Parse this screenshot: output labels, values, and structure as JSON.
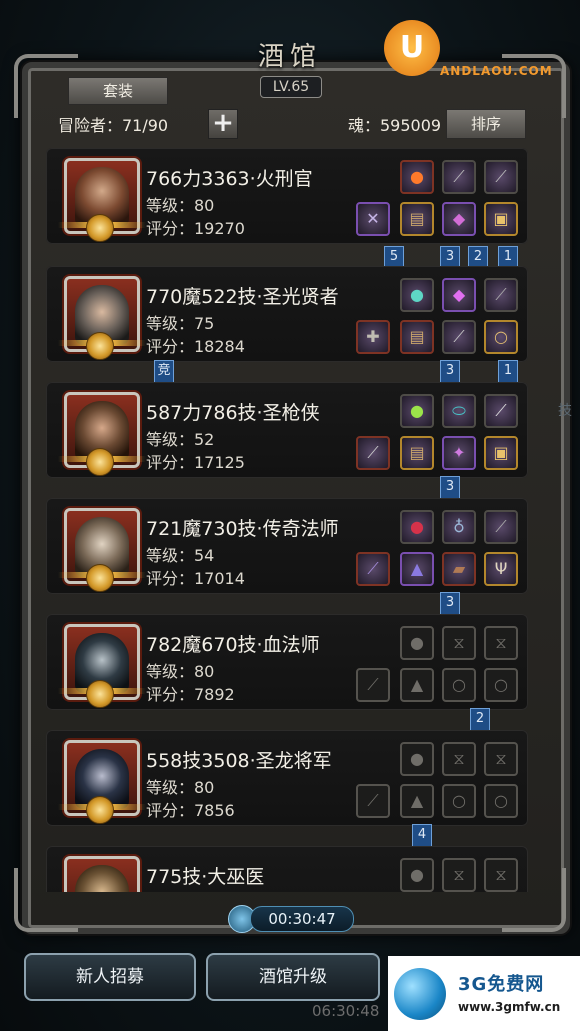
{
  "header": {
    "title": "酒馆",
    "level": "LV.65",
    "set_button": "套装",
    "adventurers": "冒险者：71/90",
    "soul": "魂：595009",
    "sort_button": "排序",
    "add_symbol": "+"
  },
  "heroes": [
    {
      "name": "766力3363·火刑官",
      "level": "等级：80",
      "score": "评分：19270",
      "portrait_color": "#8b2c1c"
    },
    {
      "name": "770魔522技·圣光贤者",
      "level": "等级：75",
      "score": "评分：18284",
      "portrait_color": "#5f5a55"
    },
    {
      "name": "587力786技·圣枪侠",
      "level": "等级：52",
      "score": "评分：17125",
      "portrait_color": "#6b4a33"
    },
    {
      "name": "721魔730技·传奇法师",
      "level": "等级：54",
      "score": "评分：17014",
      "portrait_color": "#7b6a58"
    },
    {
      "name": "782魔670技·血法师",
      "level": "等级：80",
      "score": "评分：7892",
      "portrait_color": "#2f3b44"
    },
    {
      "name": "558技3508·圣龙将军",
      "level": "等级：80",
      "score": "评分：7856",
      "portrait_color": "#2a3346"
    },
    {
      "name": "775技·大巫医",
      "level": "",
      "score": "",
      "portrait_color": "#6b5234"
    }
  ],
  "tags": {
    "t1": "5",
    "t2": "3",
    "t3": "2",
    "t4": "1",
    "t5": "竞",
    "t6": "3",
    "t7": "1",
    "t8": "3",
    "t9": "3",
    "t10": "2",
    "t11": "4"
  },
  "timer": "00:30:47",
  "buttons": {
    "recruit": "新人招募",
    "upgrade": "酒馆升级"
  },
  "ghost_timer": "06:30:48",
  "ghost_skill": "技",
  "watermark_top": {
    "symbol": "U",
    "text": "ANDLAOU.COM"
  },
  "watermark_bottom": {
    "title": "3G免费网",
    "url": "www.3gmfw.cn"
  }
}
